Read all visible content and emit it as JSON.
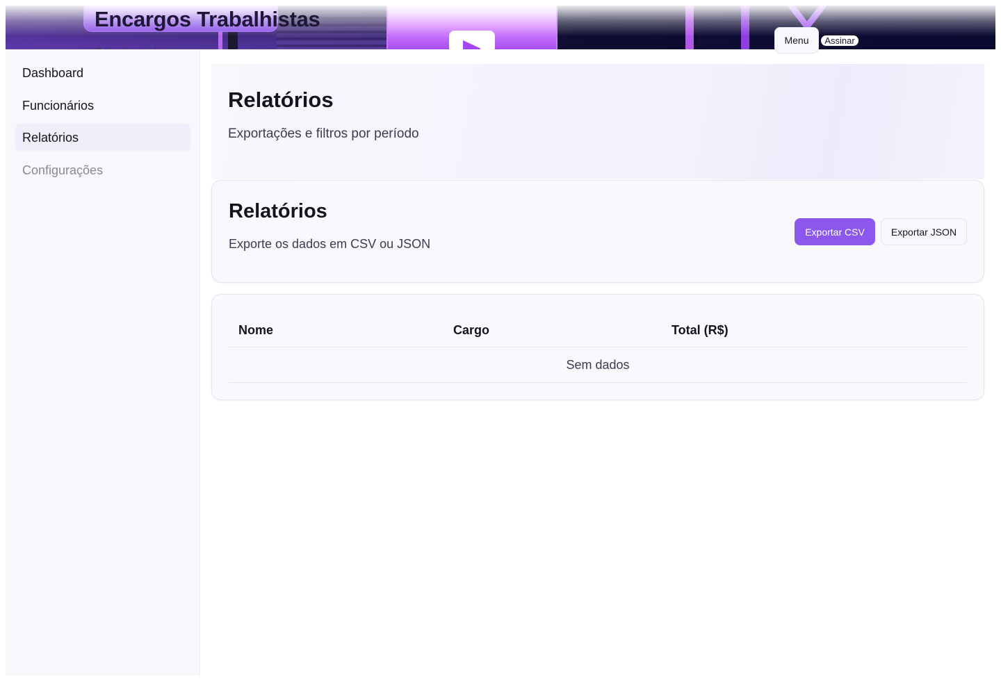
{
  "header": {
    "app_title": "Encargos Trabalhistas",
    "app_subtitle": "Cálculo e relatórios",
    "menu_label": "Menu",
    "sign_label": "Assinar"
  },
  "sidebar": {
    "items": [
      {
        "label": "Dashboard",
        "state": "default"
      },
      {
        "label": "Funcionários",
        "state": "default"
      },
      {
        "label": "Relatórios",
        "state": "active"
      },
      {
        "label": "Configurações",
        "state": "disabled"
      }
    ]
  },
  "hero": {
    "title": "Relatórios",
    "subtitle": "Exportações e filtros por período"
  },
  "export_card": {
    "title": "Relatórios",
    "description": "Exporte os dados em CSV ou JSON",
    "csv_label": "Exportar CSV",
    "json_label": "Exportar JSON"
  },
  "table": {
    "columns": [
      "Nome",
      "Cargo",
      "Total (R$)"
    ],
    "rows": [],
    "empty_text": "Sem dados"
  },
  "colors": {
    "accent": "#8c57ec",
    "active_nav_bg": "#f1eefc",
    "sidebar_bg": "#f7f7fc"
  },
  "icons": {
    "banner_video": "play-icon"
  }
}
